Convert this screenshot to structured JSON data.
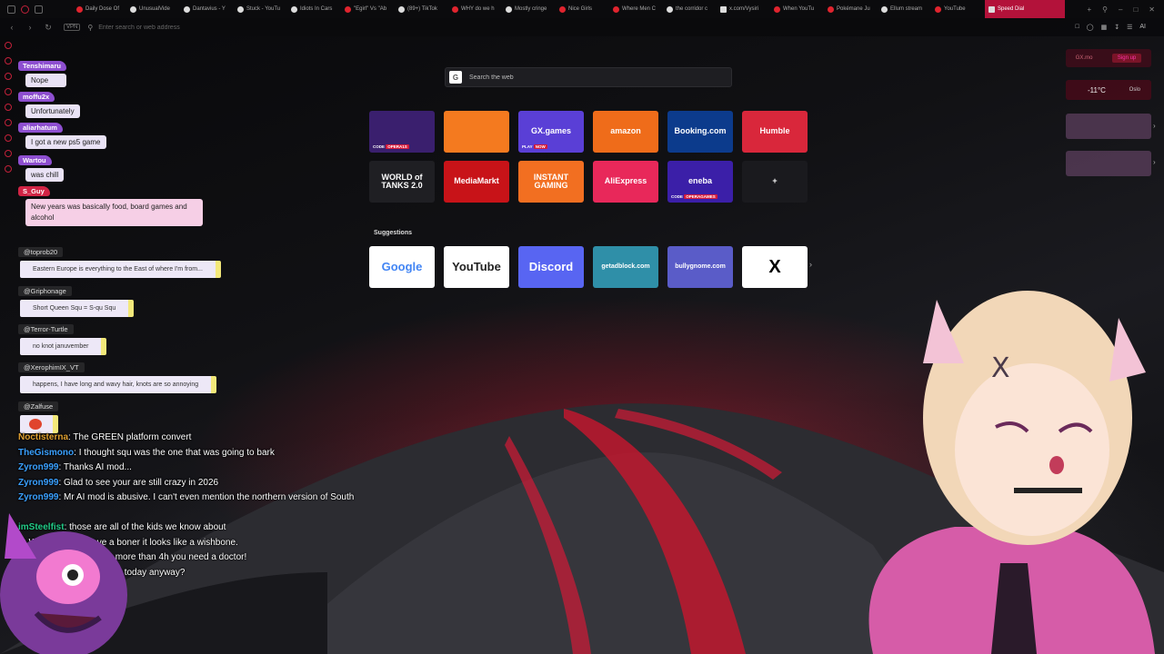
{
  "tabs": [
    {
      "title": "Daily Dose Of",
      "icon": "youtube-icon"
    },
    {
      "title": "UnusualVide",
      "icon": "page-icon"
    },
    {
      "title": "Dantavius - Y",
      "icon": "page-icon"
    },
    {
      "title": "Stuck - YouTu",
      "icon": "page-icon"
    },
    {
      "title": "Idiots In Cars",
      "icon": "page-icon"
    },
    {
      "title": "\"Egirl\" Vs \"Ab",
      "icon": "youtube-icon"
    },
    {
      "title": "(89+) TikTok",
      "icon": "page-icon"
    },
    {
      "title": "WHY do we h",
      "icon": "youtube-icon"
    },
    {
      "title": "Mostly cringe",
      "icon": "page-icon"
    },
    {
      "title": "Nice Girls",
      "icon": "youtube-icon"
    },
    {
      "title": "Where Men C",
      "icon": "youtube-icon"
    },
    {
      "title": "the corridor c",
      "icon": "page-icon"
    },
    {
      "title": "x.com/Vysiri",
      "icon": "x-icon"
    },
    {
      "title": "When YouTu",
      "icon": "youtube-icon"
    },
    {
      "title": "Pokémane Ju",
      "icon": "youtube-icon"
    },
    {
      "title": "Ellum stream",
      "icon": "page-icon"
    },
    {
      "title": "YouTube",
      "icon": "youtube-icon"
    }
  ],
  "active_tab": "Speed Dial",
  "address_bar": {
    "placeholder": "Enter search or web address",
    "vpn": "VPN",
    "right_label": "AI"
  },
  "search": {
    "placeholder": "Search the web",
    "engine_badge": "G"
  },
  "speed_dial": [
    {
      "label": "",
      "sub": "CODE",
      "code": "OPERA1S",
      "bg": "#3a1f6e"
    },
    {
      "label": "",
      "sub": "",
      "code": "",
      "bg": "#f47a1f"
    },
    {
      "label": "GX.games",
      "sub": "PLAY",
      "code": "NOW",
      "bg": "#5a3fd6"
    },
    {
      "label": "amazon",
      "sub": "",
      "code": "",
      "bg": "#ef6c1a"
    },
    {
      "label": "Booking.com",
      "sub": "",
      "code": "",
      "bg": "#0c3b8c"
    },
    {
      "label": "Humble",
      "sub": "",
      "code": "",
      "bg": "#d9273b"
    },
    {
      "label": "WORLD of TANKS 2.0",
      "sub": "",
      "code": "",
      "bg": "#1f1f23"
    },
    {
      "label": "MediaMarkt",
      "sub": "",
      "code": "",
      "bg": "#c81318"
    },
    {
      "label": "INSTANT GAMING",
      "sub": "",
      "code": "",
      "bg": "#f26f21"
    },
    {
      "label": "AliExpress",
      "sub": "",
      "code": "",
      "bg": "#e8285a"
    },
    {
      "label": "eneba",
      "sub": "CODE",
      "code": "OPERAGAMES",
      "bg": "#3b1fa8"
    },
    {
      "label": "+",
      "sub": "",
      "code": "",
      "bg": "#1a1a1e"
    }
  ],
  "suggestions_label": "Suggestions",
  "suggestions": [
    {
      "label": "Google",
      "bg": "#ffffff",
      "fg": "#4285f4"
    },
    {
      "label": "YouTube",
      "bg": "#ffffff",
      "fg": "#222222"
    },
    {
      "label": "Discord",
      "bg": "#5865f2",
      "fg": "#ffffff"
    },
    {
      "label": "getadblock.com",
      "bg": "#2f8fa8",
      "fg": "#ffffff"
    },
    {
      "label": "bullygnome.com",
      "bg": "#5a5cc8",
      "fg": "#ffffff"
    },
    {
      "label": "X",
      "bg": "#ffffff",
      "fg": "#000000"
    }
  ],
  "widgets": {
    "login": "GX.mo",
    "signup": "Sign up",
    "temperature": "-11°C",
    "city": "Oslo"
  },
  "chat_top": [
    {
      "user": "Tenshimaru",
      "text": "Nope",
      "red": false
    },
    {
      "user": "moffu2x",
      "text": "Unfortunately",
      "red": false
    },
    {
      "user": "aliarhatum",
      "text": "I got a new ps5 game",
      "red": false
    },
    {
      "user": "Wartou",
      "text": "was chill",
      "red": false
    },
    {
      "user": "S_Guy",
      "text": "New years was basically food, board games and alcohol",
      "red": true
    }
  ],
  "chat_mid": [
    {
      "user": "@toprob20",
      "text": "Eastern Europe is everything to the East of where I'm from..."
    },
    {
      "user": "@Griphonage",
      "text": "Short Queen Squ = S-qu Squ"
    },
    {
      "user": "@Terror-Turtle",
      "text": "no knot januvember"
    },
    {
      "user": "@XerophimIX_VT",
      "text": "happens, I have long and wavy hair, knots are so annoying"
    },
    {
      "user": "@Zalfuse",
      "text": ""
    }
  ],
  "chat_bottom": [
    {
      "user": "Noctisterna",
      "text": "The GREEN platform convert",
      "color": "#e0a030"
    },
    {
      "user": "TheGismono",
      "text": "I thought squ was the one that was going to bark",
      "color": "#3aa0ff"
    },
    {
      "user": "Zyron999",
      "text": "Thanks AI mod...",
      "color": "#3aa0ff"
    },
    {
      "user": "Zyron999",
      "text": "Glad to see your are still crazy in 2026",
      "color": "#3aa0ff"
    },
    {
      "user": "Zyron999",
      "text": "Mr AI mod is abusive. I can't even mention the northern version of South",
      "color": "#3aa0ff"
    },
    {
      "user": "",
      "text": "",
      "color": "#ffffff"
    },
    {
      "user": "imSteelfist",
      "text": "those are all of the kids we know about",
      "color": "#22cc88"
    },
    {
      "user": "n",
      "text": "When women have a boner it looks like a wishbone.",
      "color": "#e0a030"
    },
    {
      "user": "",
      "text": "the erection persists for more than 4h you need a doctor!",
      "color": "#ffffff"
    },
    {
      "user": "",
      "text": "leo reacts was in store for today anyway?",
      "color": "#ffffff"
    }
  ],
  "colors": {
    "accent": "#b3123a",
    "chat_name_bg": "#8e4fd0",
    "chat_name_red": "#d12445"
  }
}
